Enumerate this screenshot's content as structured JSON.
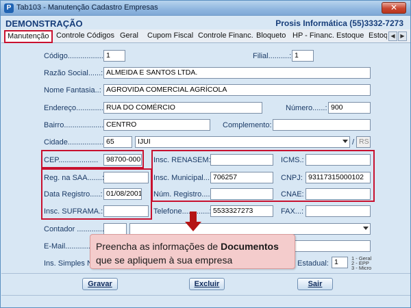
{
  "window": {
    "title": "Tab103 - Manutenção Cadastro Empresas",
    "app_icon_letter": "P",
    "close_label": "✕"
  },
  "header": {
    "company": "DEMONSTRAÇÃO",
    "vendor": "Prosis Informática (55)3332-7273"
  },
  "tabs": [
    {
      "label": "Manutenção",
      "active": true
    },
    {
      "label": "Controle Códigos"
    },
    {
      "label": "Geral"
    },
    {
      "label": "Cupom Fiscal"
    },
    {
      "label": "Controle Financ."
    },
    {
      "label": "Bloqueto"
    },
    {
      "label": "HP - Financ."
    },
    {
      "label": "Estoque"
    },
    {
      "label": "Estoq"
    }
  ],
  "tab_scroll": {
    "left": "◀",
    "right": "▶"
  },
  "form": {
    "codigo": {
      "label": "Código.................:",
      "value": "1"
    },
    "filial": {
      "label": "Filial..........:",
      "value": "1"
    },
    "razao_social": {
      "label": "Razão Social......:",
      "value": "ALMEIDA E SANTOS LTDA."
    },
    "nome_fantasia": {
      "label": "Nome Fantasia..:",
      "value": "AGROVIDA COMERCIAL AGRÍCOLA"
    },
    "endereco": {
      "label": "Endereço.............",
      "value": "RUA DO COMÉRCIO"
    },
    "numero": {
      "label": "Número......:",
      "value": "900"
    },
    "bairro": {
      "label": "Bairro.....................",
      "value": "CENTRO"
    },
    "complemento": {
      "label": "Complemento:",
      "value": ""
    },
    "cidade": {
      "label": "Cidade...................",
      "code": "65",
      "name": "IJUI",
      "separator": "/",
      "uf": "RS"
    },
    "cep": {
      "label": "CEP...................",
      "value": "98700-000"
    },
    "insc_renasem": {
      "label": "Insc. RENASEM:",
      "value": ""
    },
    "icms": {
      "label": "ICMS.:",
      "value": ""
    },
    "reg_saa": {
      "label": "Reg. na SAA.......:",
      "value": ""
    },
    "insc_municipal": {
      "label": "Insc. Municipal...:",
      "value": "706257"
    },
    "cnpj": {
      "label": "CNPJ:",
      "value": "93117315000102"
    },
    "data_registro": {
      "label": "Data Registro.....:",
      "value": "01/08/2001"
    },
    "num_registro": {
      "label": "Núm. Registro....:",
      "value": ""
    },
    "cnae": {
      "label": "CNAE:",
      "value": ""
    },
    "insc_suframa": {
      "label": "Insc. SUFRAMA.:",
      "value": ""
    },
    "telefone": {
      "label": "Telefone.............:",
      "value": "5533327273"
    },
    "fax": {
      "label": "FAX...:",
      "value": ""
    },
    "contador": {
      "label": "Contador .............:",
      "code": "",
      "name": ""
    },
    "email": {
      "label": "E-Mail...................",
      "value": ""
    },
    "simples": {
      "label": "Ins. Simples N"
    },
    "estadual": {
      "label": "Estadual:",
      "value": "1"
    },
    "estadual_legend": [
      "1 - Geral",
      "2 - EPP",
      "3 - Micro"
    ]
  },
  "callout": {
    "text_before": "Preencha as informações de ",
    "text_bold": "Documentos",
    "text_after": "que se apliquem à sua empresa"
  },
  "buttons": {
    "gravar": "Gravar",
    "excluir": "Excluir",
    "sair": "Sair"
  },
  "colors": {
    "highlight": "#c8102e",
    "panel": "#d8e7f4",
    "callout_bg": "#f4cccc",
    "arrow": "#b51414"
  }
}
